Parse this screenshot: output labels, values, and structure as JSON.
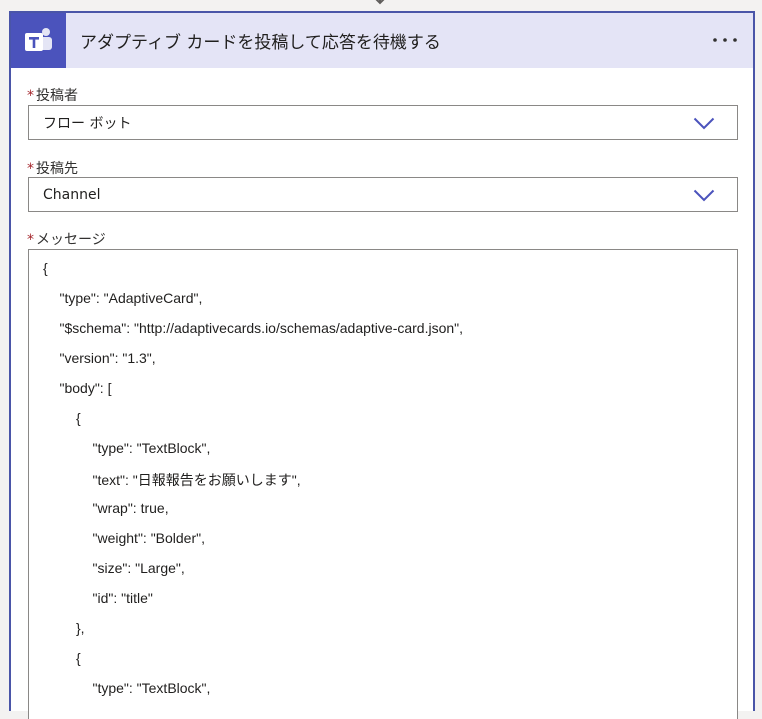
{
  "header": {
    "title": "アダプティブ カードを投稿して応答を待機する",
    "icon": "teams-icon",
    "accent_color": "#4b53bc",
    "more_label": "···"
  },
  "fields": {
    "poster": {
      "required_mark": "*",
      "label": "投稿者",
      "value": "フロー ボット"
    },
    "post_in": {
      "required_mark": "*",
      "label": "投稿先",
      "value": "Channel"
    },
    "message": {
      "required_mark": "*",
      "label": "メッセージ"
    }
  },
  "message_lines": [
    {
      "indent": 0,
      "text": "{"
    },
    {
      "indent": 1,
      "text": "\"type\": \"AdaptiveCard\","
    },
    {
      "indent": 1,
      "text": "\"$schema\": \"http://adaptivecards.io/schemas/adaptive-card.json\","
    },
    {
      "indent": 1,
      "text": "\"version\": \"1.3\","
    },
    {
      "indent": 1,
      "text": "\"body\": ["
    },
    {
      "indent": 2,
      "text": "{"
    },
    {
      "indent": 3,
      "text": "\"type\": \"TextBlock\","
    },
    {
      "indent": 3,
      "text": "\"text\": \"日報報告をお願いします\","
    },
    {
      "indent": 3,
      "text": "\"wrap\": true,"
    },
    {
      "indent": 3,
      "text": "\"weight\": \"Bolder\","
    },
    {
      "indent": 3,
      "text": "\"size\": \"Large\","
    },
    {
      "indent": 3,
      "text": "\"id\": \"title\""
    },
    {
      "indent": 2,
      "text": "},"
    },
    {
      "indent": 2,
      "text": "{"
    },
    {
      "indent": 3,
      "text": "\"type\": \"TextBlock\","
    }
  ]
}
